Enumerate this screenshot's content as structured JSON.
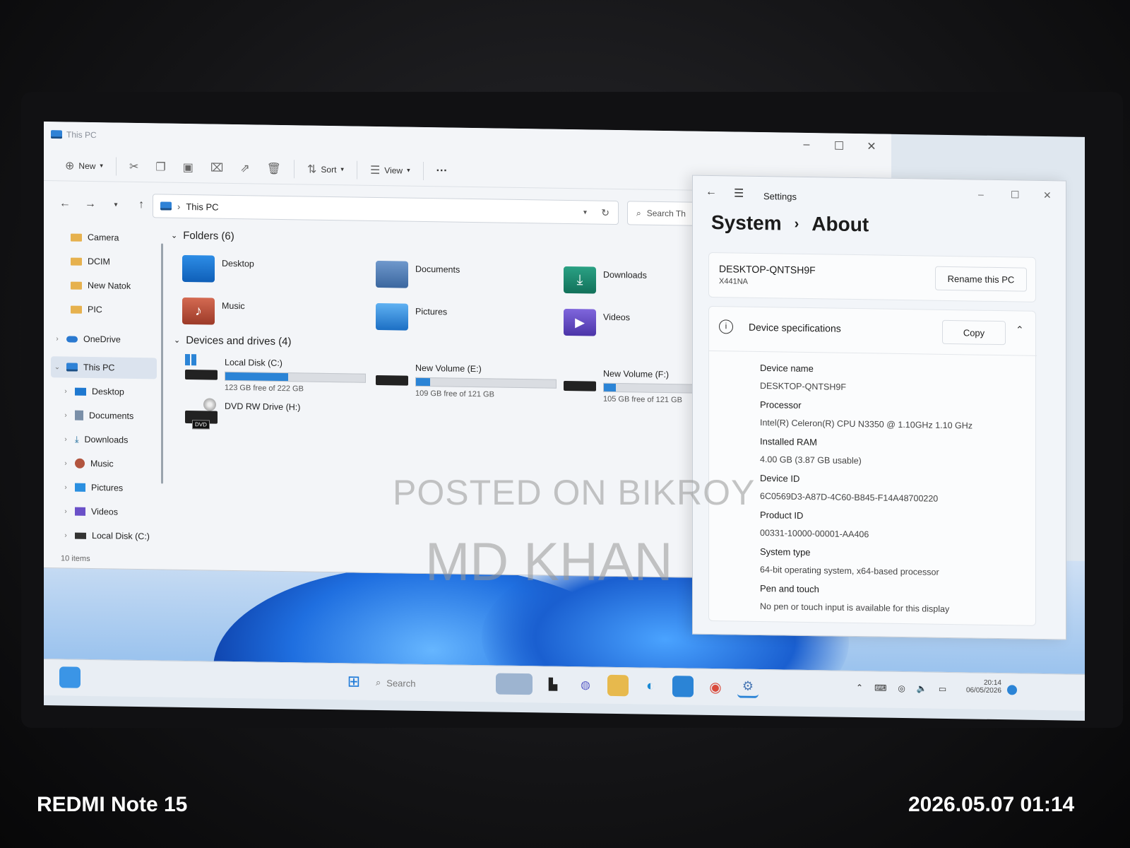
{
  "explorer": {
    "window_title": "This PC",
    "toolbar": {
      "new_label": "New",
      "sort_label": "Sort",
      "view_label": "View",
      "more_label": "···"
    },
    "address": "This PC",
    "search_placeholder": "Search Th",
    "sidebar": {
      "items": [
        {
          "label": "Camera"
        },
        {
          "label": "DCIM"
        },
        {
          "label": "New Natok"
        },
        {
          "label": "PIC"
        },
        {
          "label": "OneDrive"
        },
        {
          "label": "This PC"
        },
        {
          "label": "Desktop"
        },
        {
          "label": "Documents"
        },
        {
          "label": "Downloads"
        },
        {
          "label": "Music"
        },
        {
          "label": "Pictures"
        },
        {
          "label": "Videos"
        },
        {
          "label": "Local Disk (C:)"
        }
      ]
    },
    "status": "10 items",
    "folders_header": "Folders (6)",
    "folders": [
      {
        "label": "Desktop",
        "color": "#1e78d0"
      },
      {
        "label": "Documents",
        "color": "#4a7fc0"
      },
      {
        "label": "Downloads",
        "color": "#1b8a6b"
      },
      {
        "label": "Music",
        "color": "#c0503c"
      },
      {
        "label": "Pictures",
        "color": "#2a8fe0"
      },
      {
        "label": "Videos",
        "color": "#6a50c8"
      }
    ],
    "drives_header": "Devices and drives (4)",
    "drives": [
      {
        "label": "Local Disk (C:)",
        "free": "123 GB free of 222 GB",
        "used_fraction": 0.45
      },
      {
        "label": "New Volume (E:)",
        "free": "109 GB free of 121 GB",
        "used_fraction": 0.1
      },
      {
        "label": "New Volume (F:)",
        "free": "105 GB free of 121 GB",
        "used_fraction": 0.13
      },
      {
        "label": "DVD RW Drive (H:)",
        "badge": "DVD"
      }
    ]
  },
  "settings": {
    "title": "Settings",
    "breadcrumb_parent": "System",
    "breadcrumb_sep": "›",
    "breadcrumb_current": "About",
    "device_name_header": "DESKTOP-QNTSH9F",
    "model": "X441NA",
    "rename_label": "Rename this PC",
    "specs_header": "Device specifications",
    "copy_label": "Copy",
    "specs": [
      {
        "label": "Device name",
        "value": "DESKTOP-QNTSH9F"
      },
      {
        "label": "Processor",
        "value": "Intel(R) Celeron(R) CPU N3350 @ 1.10GHz   1.10 GHz"
      },
      {
        "label": "Installed RAM",
        "value": "4.00 GB (3.87 GB usable)"
      },
      {
        "label": "Device ID",
        "value": "6C0569D3-A87D-4C60-B845-F14A48700220"
      },
      {
        "label": "Product ID",
        "value": "00331-10000-00001-AA406"
      },
      {
        "label": "System type",
        "value": "64-bit operating system, x64-based processor"
      },
      {
        "label": "Pen and touch",
        "value": "No pen or touch input is available for this display"
      }
    ]
  },
  "taskbar": {
    "search_placeholder": "Search",
    "time": "20:14",
    "date": "06/05/2026"
  },
  "watermark": {
    "line1": "POSTED ON BIKROY",
    "line2": "MD KHAN"
  },
  "camera_stamp": {
    "device": "REDMI Note 15",
    "datetime": "2026.05.07 01:14"
  },
  "colors": {
    "accent": "#2b84d6",
    "wallpaper": "#2a7fe0"
  }
}
